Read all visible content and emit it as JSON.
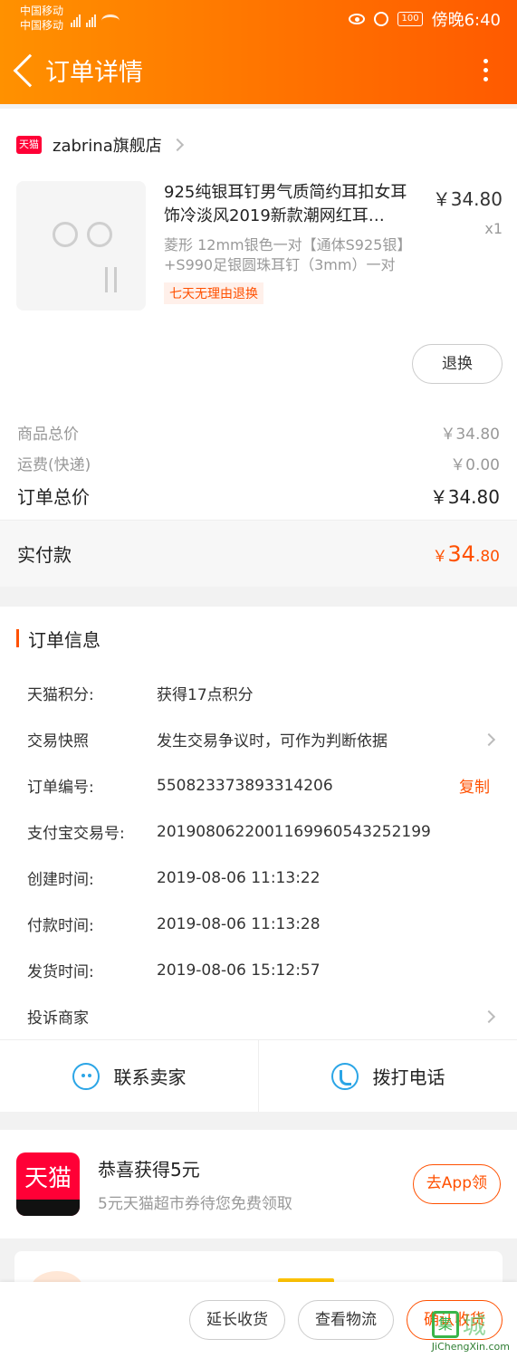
{
  "status_bar": {
    "carrier1": "中国移动",
    "carrier2": "中国移动",
    "battery": "100",
    "time": "傍晚6:40"
  },
  "nav": {
    "title": "订单详情"
  },
  "store": {
    "badge": "天猫",
    "name": "zabrina旗舰店"
  },
  "product": {
    "title": "925纯银耳钉男气质简约耳扣女耳饰冷淡风2019新款潮网红耳…",
    "spec": "菱形 12mm银色一对【通体S925银】+S990足银圆珠耳钉（3mm）一对",
    "tag": "七天无理由退换",
    "price": "￥34.80",
    "qty": "x1",
    "refund_label": "退换"
  },
  "summary": [
    {
      "label": "商品总价",
      "value": "￥34.80"
    },
    {
      "label": "运费(快递)",
      "value": "￥0.00"
    },
    {
      "label": "订单总价",
      "value": "￥34.80"
    }
  ],
  "paid": {
    "label": "实付款",
    "currency": "￥",
    "integer": "34",
    "decimal": ".80"
  },
  "order_info": {
    "title": "订单信息",
    "rows": [
      {
        "label": "天猫积分:",
        "value": "获得17点积分"
      },
      {
        "label": "交易快照",
        "value": "发生交易争议时，可作为判断依据"
      },
      {
        "label": "订单编号:",
        "value": "550823373893314206",
        "action": "复制"
      },
      {
        "label": "支付宝交易号:",
        "value": "2019080622001169960543252199"
      },
      {
        "label": "创建时间:",
        "value": "2019-08-06 11:13:22"
      },
      {
        "label": "付款时间:",
        "value": "2019-08-06 11:13:28"
      },
      {
        "label": "发货时间:",
        "value": "2019-08-06 15:12:57"
      },
      {
        "label": "投诉商家",
        "value": ""
      }
    ]
  },
  "contact": {
    "seller": "联系卖家",
    "call": "拨打电话"
  },
  "promo": {
    "logo_text": "天猫",
    "title": "恭喜获得5元",
    "subtitle": "5元天猫超市券待您免费领取",
    "button": "去App领"
  },
  "bottom_bar": {
    "extend": "延长收货",
    "logistics": "查看物流",
    "confirm": "确认收货"
  },
  "watermark": {
    "box": "集",
    "cn": "城",
    "en": "JiChengXin.com"
  }
}
